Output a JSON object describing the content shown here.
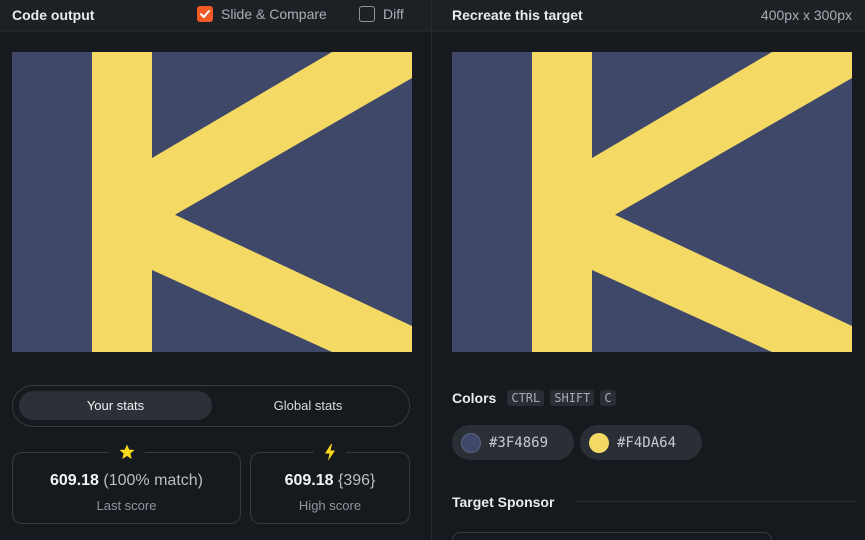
{
  "left_panel": {
    "title": "Code output",
    "slide_compare": {
      "label": "Slide & Compare",
      "checked": true
    },
    "diff": {
      "label": "Diff",
      "checked": false
    }
  },
  "right_panel": {
    "title": "Recreate this target",
    "dimensions": "400px x 300px"
  },
  "stats_tabs": {
    "your_stats": "Your stats",
    "global_stats": "Global stats",
    "active": "your_stats"
  },
  "last_score": {
    "icon": "star-icon",
    "value": "609.18",
    "detail": "(100% match)",
    "label": "Last score"
  },
  "high_score": {
    "icon": "bolt-icon",
    "value": "609.18",
    "detail": "{396}",
    "label": "High score"
  },
  "colors": {
    "title": "Colors",
    "shortcut": [
      "CTRL",
      "SHIFT",
      "C"
    ],
    "swatches": [
      {
        "hex": "#3F4869"
      },
      {
        "hex": "#F4DA64"
      }
    ]
  },
  "sponsor": {
    "title": "Target Sponsor"
  },
  "canvas_colors": {
    "background": "#3f4869",
    "foreground": "#f4da64"
  }
}
